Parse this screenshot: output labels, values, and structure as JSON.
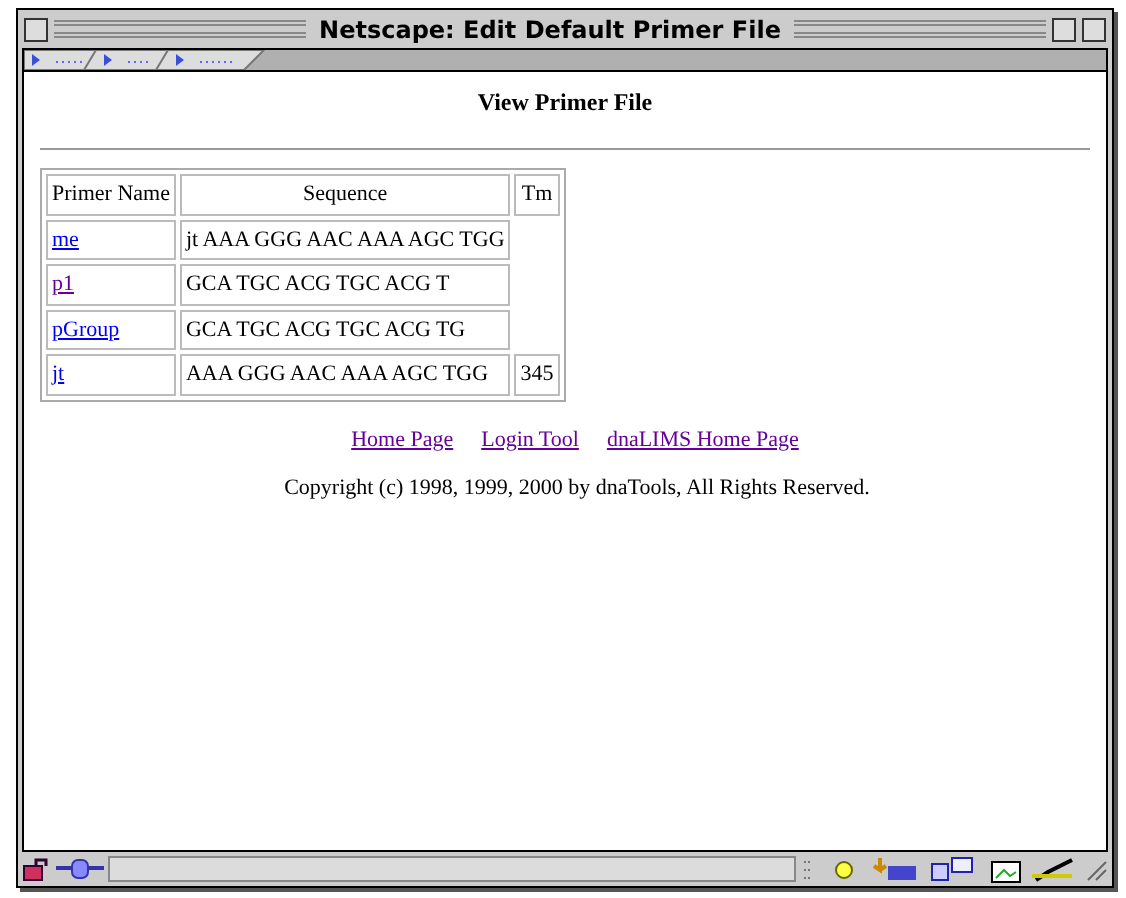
{
  "window": {
    "title": "Netscape: Edit Default Primer File"
  },
  "heading": "View Primer File",
  "table": {
    "columns": [
      "Primer Name",
      "Sequence",
      "Tm"
    ],
    "rows": [
      {
        "name": "me",
        "visited": false,
        "sequence": "jt AAA GGG AAC AAA AGC TGG"
      },
      {
        "name": "p1",
        "visited": true,
        "sequence": "GCA TGC ACG TGC ACG T"
      },
      {
        "name": "pGroup",
        "visited": false,
        "sequence": "GCA TGC ACG TGC ACG TG"
      },
      {
        "name": "jt",
        "visited": false,
        "sequence": "AAA GGG AAC AAA AGC TGG",
        "tm": "345"
      }
    ]
  },
  "links": [
    {
      "label": "Home Page",
      "visited": true
    },
    {
      "label": "Login Tool",
      "visited": true
    },
    {
      "label": "dnaLIMS Home Page",
      "visited": true
    }
  ],
  "copyright": "Copyright (c) 1998, 1999, 2000 by dnaTools, All Rights Reserved."
}
